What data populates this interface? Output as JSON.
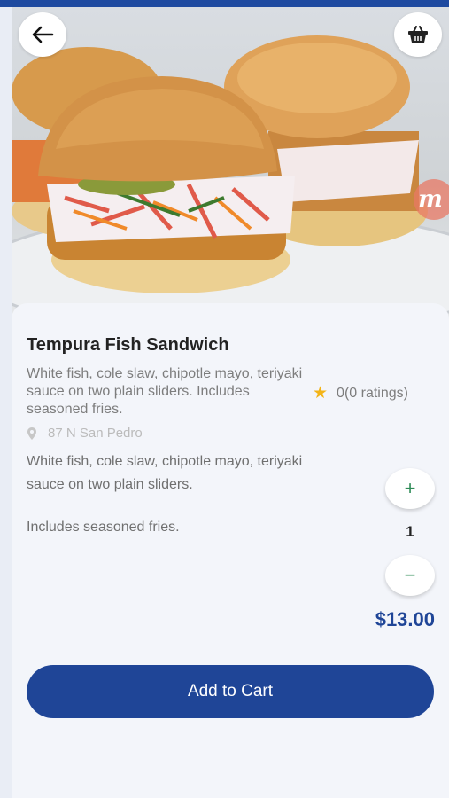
{
  "product": {
    "title": "Tempura Fish Sandwich",
    "summary": "White fish, cole slaw, chipotle mayo, teriyaki sauce on two plain sliders. Includes seasoned fries.",
    "rating_text": "0(0 ratings)",
    "location": "87 N San Pedro",
    "description_line1": "White fish, cole slaw, chipotle mayo, teriyaki sauce on two plain sliders.",
    "description_line2": "Includes seasoned fries.",
    "price": "$13.00"
  },
  "stepper": {
    "plus_label": "+",
    "quantity": "1",
    "minus_label": "−"
  },
  "cart": {
    "button_label": "Add to Cart"
  },
  "badge": {
    "letter": "m"
  },
  "icons": {
    "back": "arrow-left-icon",
    "basket": "basket-icon",
    "star": "star-icon",
    "location": "map-pin-icon"
  },
  "colors": {
    "brand": "#1f4597",
    "star": "#f3b417",
    "stepper": "#2e8b57"
  }
}
